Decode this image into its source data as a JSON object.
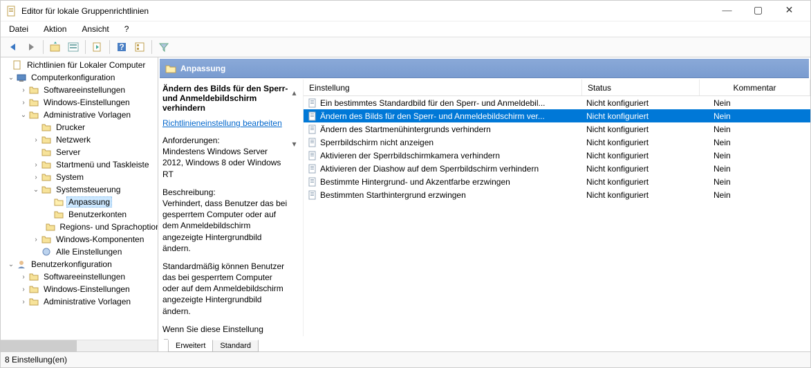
{
  "window": {
    "title": "Editor für lokale Gruppenrichtlinien",
    "minimize": "—",
    "maximize": "▢",
    "close": "✕"
  },
  "menu": [
    "Datei",
    "Aktion",
    "Ansicht",
    "?"
  ],
  "tree": {
    "root": "Richtlinien für Lokaler Computer",
    "computer_conf": "Computerkonfiguration",
    "software": "Softwareeinstellungen",
    "windows_settings": "Windows-Einstellungen",
    "admin_templates": "Administrative Vorlagen",
    "drucker": "Drucker",
    "netzwerk": "Netzwerk",
    "server": "Server",
    "startmenu": "Startmenü und Taskleiste",
    "system": "System",
    "systemsteuerung": "Systemsteuerung",
    "anpassung": "Anpassung",
    "benutzerkonten": "Benutzerkonten",
    "regions": "Regions- und Sprachoptionen",
    "win_components": "Windows-Komponenten",
    "alle": "Alle Einstellungen",
    "user_conf": "Benutzerkonfiguration",
    "u_software": "Softwareeinstellungen",
    "u_windows": "Windows-Einstellungen",
    "u_admin": "Administrative Vorlagen"
  },
  "folder_header": "Anpassung",
  "detail": {
    "title": "Ändern des Bilds für den Sperr- und Anmeldebildschirm verhindern",
    "edit_link": "Richtlinieneinstellung bearbeiten",
    "req_label": "Anforderungen:",
    "req_text": "Mindestens Windows Server 2012, Windows 8 oder Windows RT",
    "desc_label": "Beschreibung:",
    "desc_text1": "Verhindert, dass Benutzer das bei gesperrtem Computer oder auf dem Anmeldebildschirm angezeigte Hintergrundbild ändern.",
    "desc_text2": "Standardmäßig können Benutzer das bei gesperrtem Computer oder auf dem Anmeldebildschirm angezeigte Hintergrundbild ändern.",
    "desc_text3": "Wenn Sie diese Einstellung aktivieren, können Benutzer das"
  },
  "list": {
    "headers": {
      "setting": "Einstellung",
      "status": "Status",
      "comment": "Kommentar"
    },
    "status_nc": "Nicht konfiguriert",
    "comment_no": "Nein",
    "rows": [
      "Ein bestimmtes Standardbild für den Sperr- und Anmeldebil...",
      "Ändern des Bilds für den Sperr- und Anmeldebildschirm ver...",
      "Ändern des Startmenühintergrunds verhindern",
      "Sperrbildschirm nicht anzeigen",
      "Aktivieren der Sperrbildschirmkamera verhindern",
      "Aktivieren der Diashow auf dem Sperrbildschirm verhindern",
      "Bestimmte Hintergrund- und Akzentfarbe erzwingen",
      "Bestimmten Starthintergrund erzwingen"
    ],
    "selected_index": 1
  },
  "tabs": {
    "extended": "Erweitert",
    "standard": "Standard"
  },
  "status_bar": "8 Einstellung(en)"
}
